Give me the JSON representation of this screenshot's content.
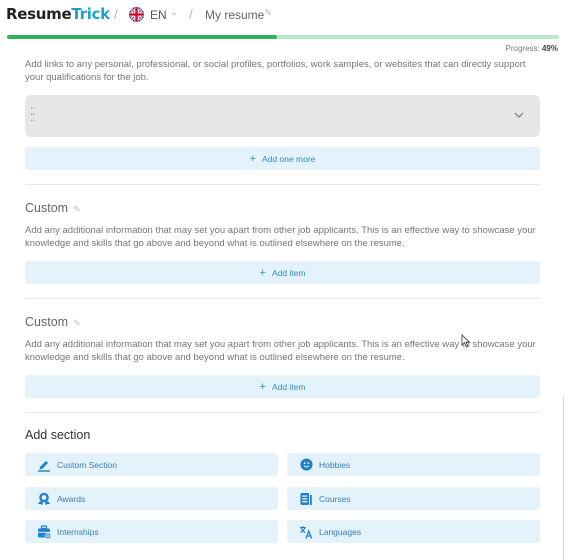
{
  "header": {
    "logo_part1": "Resume",
    "logo_part2": "Trick",
    "separator": "/",
    "language": "EN",
    "language_chevron": "⌄",
    "document_name": "My resume",
    "edit_icon": "✎"
  },
  "progress": {
    "label": "Progress:",
    "value_text": "49%",
    "value": 0.49
  },
  "links_section": {
    "description": "Add links to any personal, professional, or social profiles, portfolios, work samples, or websites that can directly support your qualifications for the job.",
    "add_button": "Add one more",
    "plus": "+"
  },
  "custom_sections": [
    {
      "title": "Custom",
      "description": "Add any additional information that may set you apart from other job applicants. This is an effective way to showcase your knowledge and skills that go above and beyond what is outlined elsewhere on the resume.",
      "add_button": "Add item"
    },
    {
      "title": "Custom",
      "description": "Add any additional information that may set you apart from other job applicants. This is an effective way to showcase your knowledge and skills that go above and beyond what is outlined elsewhere on the resume.",
      "add_button": "Add item"
    }
  ],
  "add_section": {
    "title": "Add section",
    "items": [
      {
        "label": "Custom Section",
        "icon": "pencil-icon"
      },
      {
        "label": "Hobbies",
        "icon": "smiley-icon"
      },
      {
        "label": "Awards",
        "icon": "award-icon"
      },
      {
        "label": "Courses",
        "icon": "book-icon"
      },
      {
        "label": "Internships",
        "icon": "briefcase-icon"
      },
      {
        "label": "Languages",
        "icon": "translate-icon"
      }
    ]
  },
  "colors": {
    "brand_dark": "#222222",
    "brand_accent": "#1aa3c8",
    "progress_fill": "#2db35e",
    "progress_track": "#b6e8c9",
    "button_bg": "#e3f2fb",
    "button_text": "#3a7fb0",
    "icon_blue": "#1f7fd0"
  }
}
